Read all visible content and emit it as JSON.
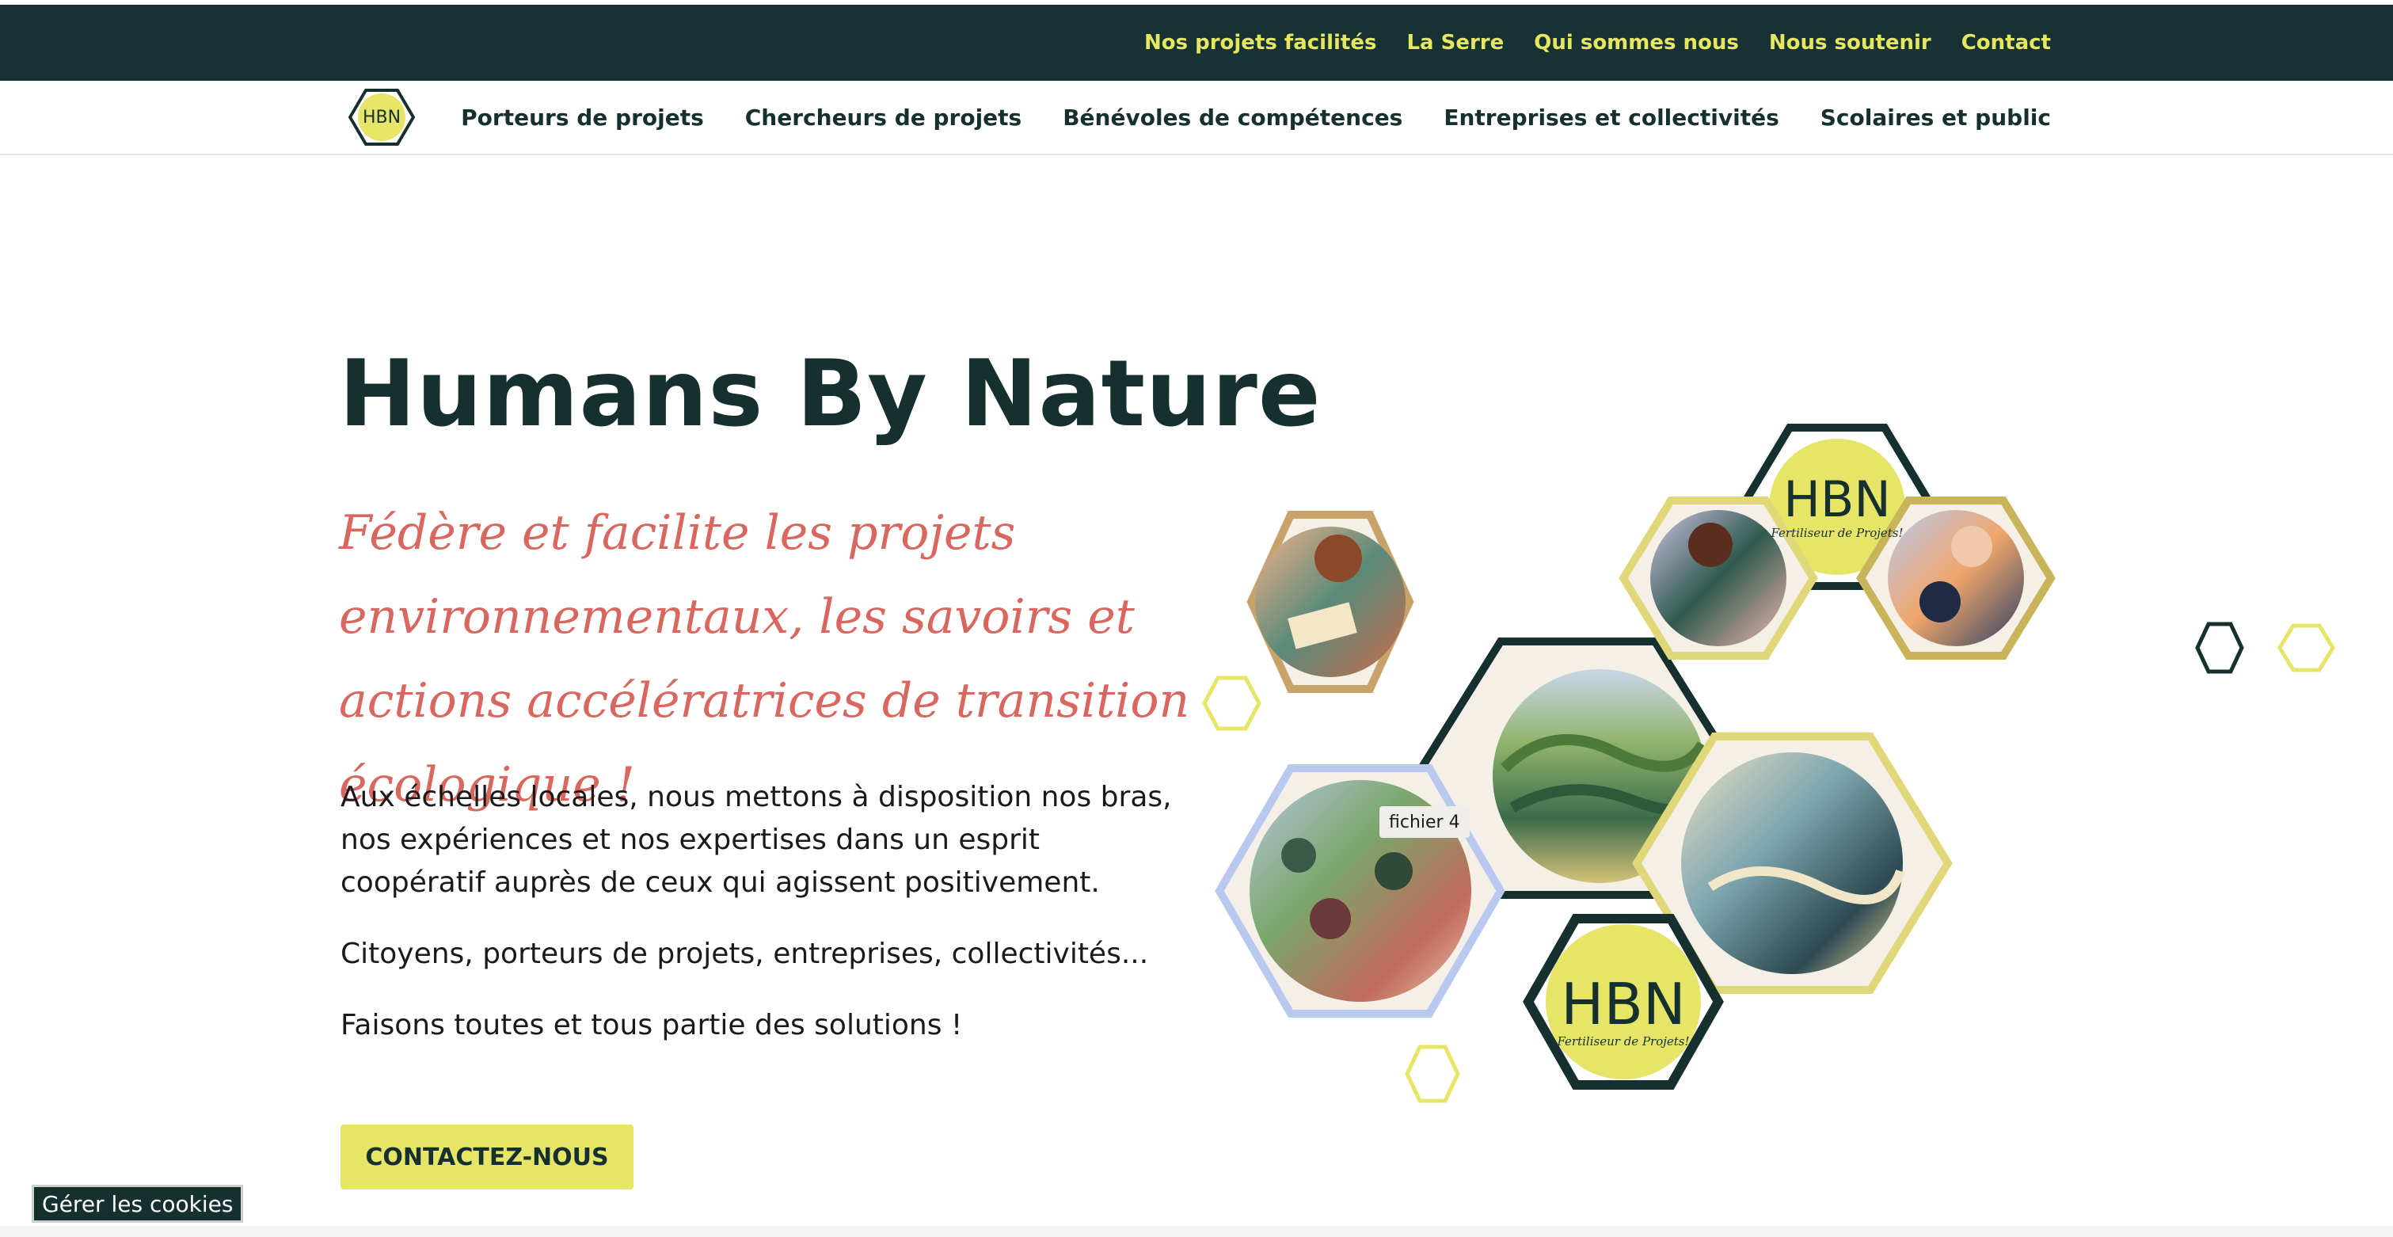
{
  "top_nav": {
    "links": [
      "Nos projets facilités",
      "La Serre",
      "Qui sommes nous",
      "Nous soutenir",
      "Contact"
    ]
  },
  "main_nav": {
    "logo_text": "HBN",
    "links": [
      "Porteurs de projets",
      "Chercheurs de projets",
      "Bénévoles de compétences",
      "Entreprises et collectivités",
      "Scolaires et public"
    ]
  },
  "hero": {
    "title": "Humans By Nature",
    "tagline": "Fédère et facilite les projets environnementaux, les savoirs et actions accélératrices de transition écologique !",
    "paragraphs": [
      "Aux échelles locales, nous mettons à disposition nos bras, nos expériences et nos expertises dans un esprit coopératif auprès de ceux qui agissent positivement.",
      "Citoyens, porteurs de projets, entreprises, collectivités...",
      "Faisons toutes et tous partie des solutions !"
    ],
    "cta_label": "CONTACTEZ-NOUS"
  },
  "illustration": {
    "tooltip": "fichier 4",
    "logo_abbr": "HBN",
    "logo_sub": "Fertiliseur de Projets!"
  },
  "cookie_button": "Gérer les cookies",
  "colors": {
    "dark_green": "#163232",
    "accent_yellow": "#e6e567",
    "tagline_coral": "#d9675f"
  }
}
